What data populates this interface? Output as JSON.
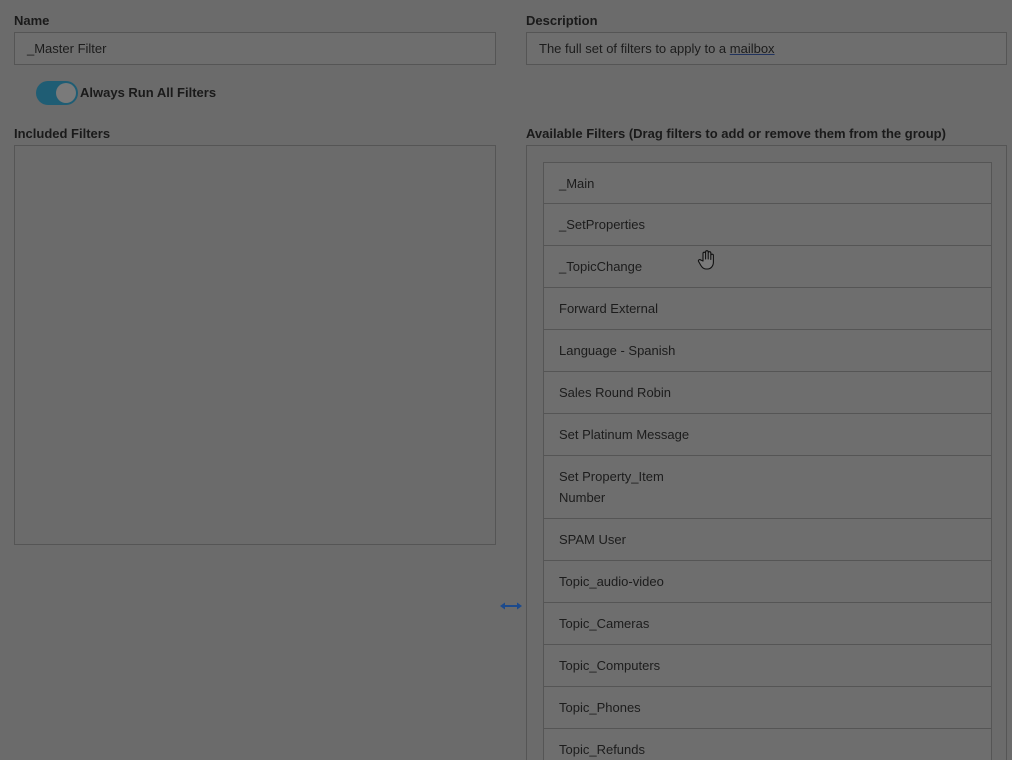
{
  "name": {
    "label": "Name",
    "value": "_Master Filter"
  },
  "description": {
    "label": "Description",
    "value_prefix": "The full set of filters to apply to a ",
    "value_link": "mailbox"
  },
  "always_run": {
    "label": "Always Run All Filters",
    "checked": true
  },
  "included_filters": {
    "label": "Included Filters",
    "items": []
  },
  "available_filters": {
    "label": "Available Filters (Drag filters to add or remove them from the group)",
    "items": [
      "_Main",
      "_SetProperties",
      "_TopicChange",
      "Forward External",
      "Language - Spanish",
      "Sales Round Robin",
      "Set Platinum Message",
      "Set Property_Item Number",
      "SPAM User",
      "Topic_audio-video",
      "Topic_Cameras",
      "Topic_Computers",
      "Topic_Phones",
      "Topic_Refunds"
    ]
  },
  "icons": {
    "resize": "horizontal-resize-icon",
    "cursor": "grab-hand-icon"
  },
  "colors": {
    "toggle_on": "#1f5d74",
    "resize_icon": "#1c4a8c"
  }
}
